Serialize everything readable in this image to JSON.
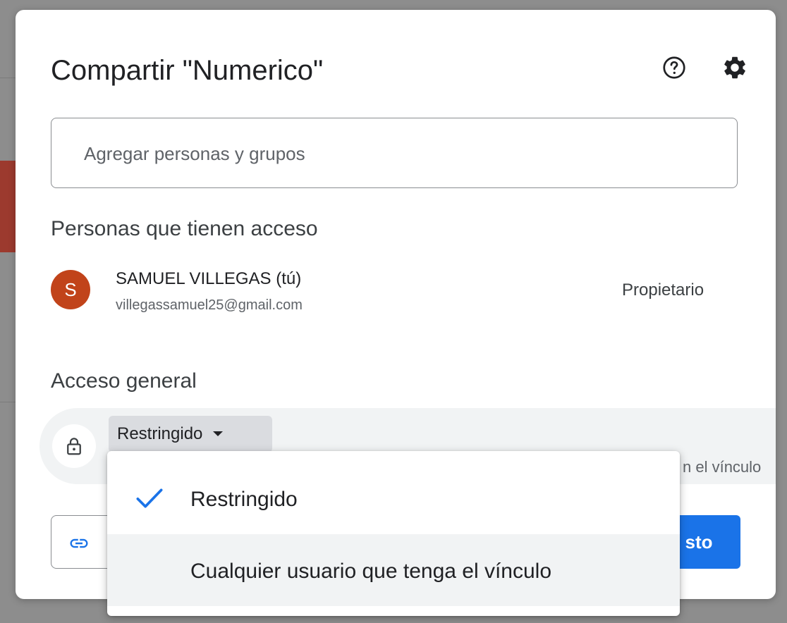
{
  "dialog": {
    "title": "Compartir \"Numerico\"",
    "help_icon": "help-circle-icon",
    "settings_icon": "gear-icon"
  },
  "search": {
    "placeholder": "Agregar personas y grupos",
    "value": ""
  },
  "people_section": {
    "heading": "Personas que tienen acceso",
    "people": [
      {
        "avatar_letter": "S",
        "avatar_color": "#c1431a",
        "name": "SAMUEL VILLEGAS (tú)",
        "email": "villegassamuel25@gmail.com",
        "role": "Propietario"
      }
    ]
  },
  "general_access": {
    "heading": "Acceso general",
    "icon": "lock-icon",
    "selected": "Restringido",
    "description_visible": "n el vínculo"
  },
  "dropdown": {
    "options": [
      {
        "label": "Restringido",
        "checked": true
      },
      {
        "label": "Cualquier usuario que tenga el vínculo",
        "checked": false,
        "hovered": true
      }
    ]
  },
  "footer": {
    "copy_link_icon": "link-icon",
    "done_label_visible": "sto"
  },
  "colors": {
    "primary": "#1a73e8",
    "avatar": "#c1431a",
    "text": "#202124",
    "secondary_text": "#5f6368"
  }
}
